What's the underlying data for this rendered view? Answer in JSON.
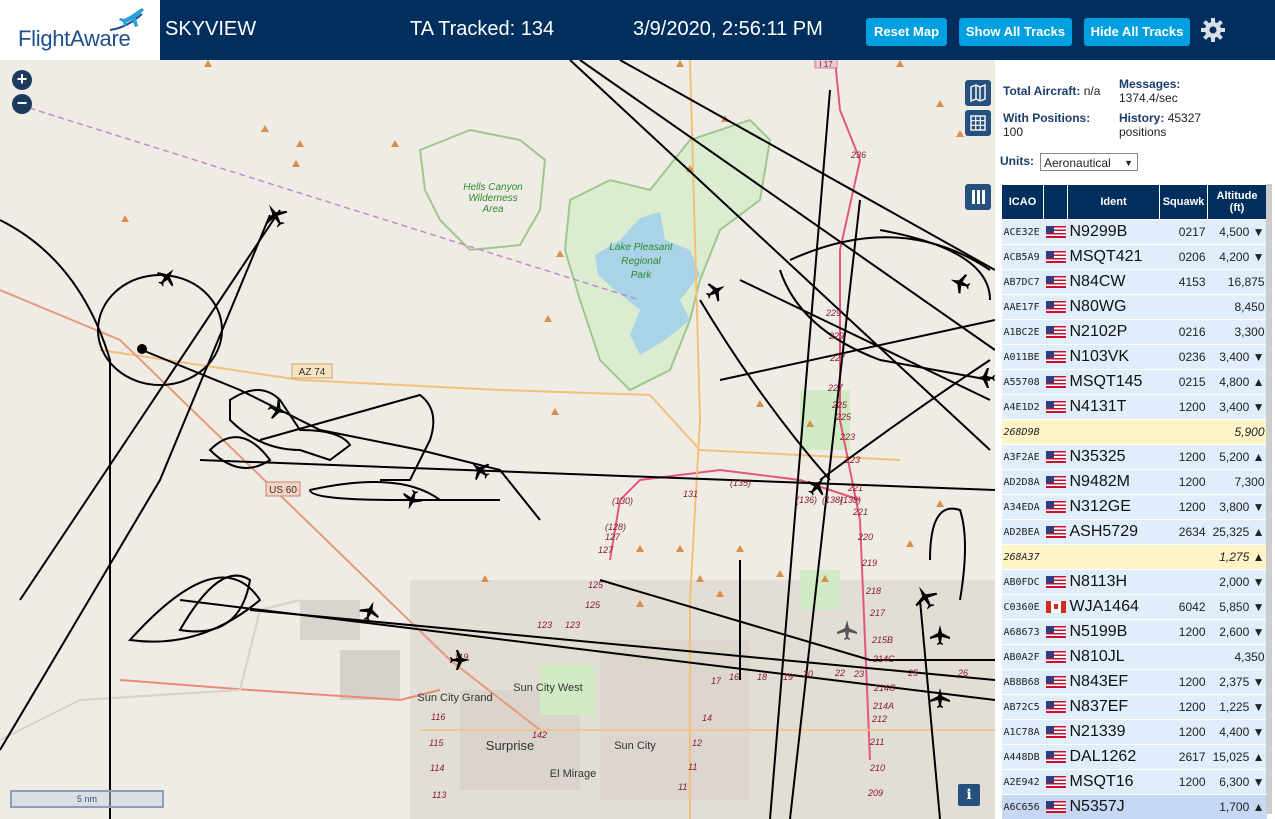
{
  "header": {
    "logo_text": "FlightAware",
    "app_name": "SKYVIEW",
    "ta_tracked": "TA Tracked: 134",
    "datetime": "3/9/2020, 2:56:11 PM",
    "buttons": {
      "reset": "Reset Map",
      "show": "Show All Tracks",
      "hide": "Hide All Tracks"
    },
    "gear_icon": "gear-icon"
  },
  "map": {
    "labels": {
      "wilderness": [
        "Hells Canyon",
        "Wilderness",
        "Area"
      ],
      "park": [
        "Lake Pleasant",
        "Regional",
        "Park"
      ],
      "sun_city_grand": "Sun City Grand",
      "sun_city_west": "Sun City West",
      "surprise": "Surprise",
      "sun_city": "Sun City",
      "el_mirage": "El Mirage",
      "az74": "AZ 74",
      "us60": "US 60",
      "i17": "I 17"
    },
    "scale": "5 nm",
    "info": "i"
  },
  "stats": {
    "total_aircraft_label": "Total Aircraft:",
    "total_aircraft_value": "n/a",
    "messages_label": "Messages:",
    "messages_value": "1374.4/sec",
    "with_positions_label": "With Positions:",
    "with_positions_value": "100",
    "history_label": "History:",
    "history_value": "45327",
    "history_unit": "positions",
    "units_label": "Units:",
    "units_value": "Aeronautical"
  },
  "table": {
    "headers": [
      "ICAO",
      "",
      "Ident",
      "Squawk",
      "Altitude (ft)"
    ],
    "rows": [
      {
        "icao": "ACE32E",
        "flag": "us",
        "ident": "N9299B",
        "squawk": "0217",
        "alt": "4,500 ▼",
        "style": "row"
      },
      {
        "icao": "ACB5A9",
        "flag": "us",
        "ident": "MSQT421",
        "squawk": "0206",
        "alt": "4,200 ▼",
        "style": "row"
      },
      {
        "icao": "AB7DC7",
        "flag": "us",
        "ident": "N84CW",
        "squawk": "4153",
        "alt": "16,875",
        "style": "row"
      },
      {
        "icao": "AAE17F",
        "flag": "us",
        "ident": "N80WG",
        "squawk": "",
        "alt": "8,450",
        "style": "row"
      },
      {
        "icao": "A1BC2E",
        "flag": "us",
        "ident": "N2102P",
        "squawk": "0216",
        "alt": "3,300",
        "style": "row"
      },
      {
        "icao": "A011BE",
        "flag": "us",
        "ident": "N103VK",
        "squawk": "0236",
        "alt": "3,400 ▼",
        "style": "row"
      },
      {
        "icao": "A55708",
        "flag": "us",
        "ident": "MSQT145",
        "squawk": "0215",
        "alt": "4,800 ▲",
        "style": "row"
      },
      {
        "icao": "A4E1D2",
        "flag": "us",
        "ident": "N4131T",
        "squawk": "1200",
        "alt": "3,400 ▼",
        "style": "row"
      },
      {
        "icao": "268D9B",
        "flag": "",
        "ident": "",
        "squawk": "",
        "alt": "5,900",
        "style": "row alt"
      },
      {
        "icao": "A3F2AE",
        "flag": "us",
        "ident": "N35325",
        "squawk": "1200",
        "alt": "5,200 ▲",
        "style": "row"
      },
      {
        "icao": "AD2D8A",
        "flag": "us",
        "ident": "N9482M",
        "squawk": "1200",
        "alt": "7,300",
        "style": "row"
      },
      {
        "icao": "A34EDA",
        "flag": "us",
        "ident": "N312GE",
        "squawk": "1200",
        "alt": "3,800 ▼",
        "style": "row"
      },
      {
        "icao": "AD2BEA",
        "flag": "us",
        "ident": "ASH5729",
        "squawk": "2634",
        "alt": "25,325 ▲",
        "style": "row"
      },
      {
        "icao": "268A37",
        "flag": "",
        "ident": "",
        "squawk": "",
        "alt": "1,275 ▲",
        "style": "row alt"
      },
      {
        "icao": "AB0FDC",
        "flag": "us",
        "ident": "N8113H",
        "squawk": "",
        "alt": "2,000 ▼",
        "style": "row"
      },
      {
        "icao": "C0360E",
        "flag": "ca",
        "ident": "WJA1464",
        "squawk": "6042",
        "alt": "5,850 ▼",
        "style": "row"
      },
      {
        "icao": "A68673",
        "flag": "us",
        "ident": "N5199B",
        "squawk": "1200",
        "alt": "2,600 ▼",
        "style": "row"
      },
      {
        "icao": "AB0A2F",
        "flag": "us",
        "ident": "N810JL",
        "squawk": "",
        "alt": "4,350",
        "style": "row"
      },
      {
        "icao": "AB8B68",
        "flag": "us",
        "ident": "N843EF",
        "squawk": "1200",
        "alt": "2,375 ▼",
        "style": "row"
      },
      {
        "icao": "AB72C5",
        "flag": "us",
        "ident": "N837EF",
        "squawk": "1200",
        "alt": "1,225 ▼",
        "style": "row"
      },
      {
        "icao": "A1C78A",
        "flag": "us",
        "ident": "N21339",
        "squawk": "1200",
        "alt": "4,400 ▼",
        "style": "row"
      },
      {
        "icao": "A448DB",
        "flag": "us",
        "ident": "DAL1262",
        "squawk": "2617",
        "alt": "15,025 ▲",
        "style": "row"
      },
      {
        "icao": "A2E942",
        "flag": "us",
        "ident": "MSQT16",
        "squawk": "1200",
        "alt": "6,300 ▼",
        "style": "row"
      },
      {
        "icao": "A6C656",
        "flag": "us",
        "ident": "N5357J",
        "squawk": "",
        "alt": "1,700 ▲",
        "style": "row sel"
      }
    ]
  }
}
